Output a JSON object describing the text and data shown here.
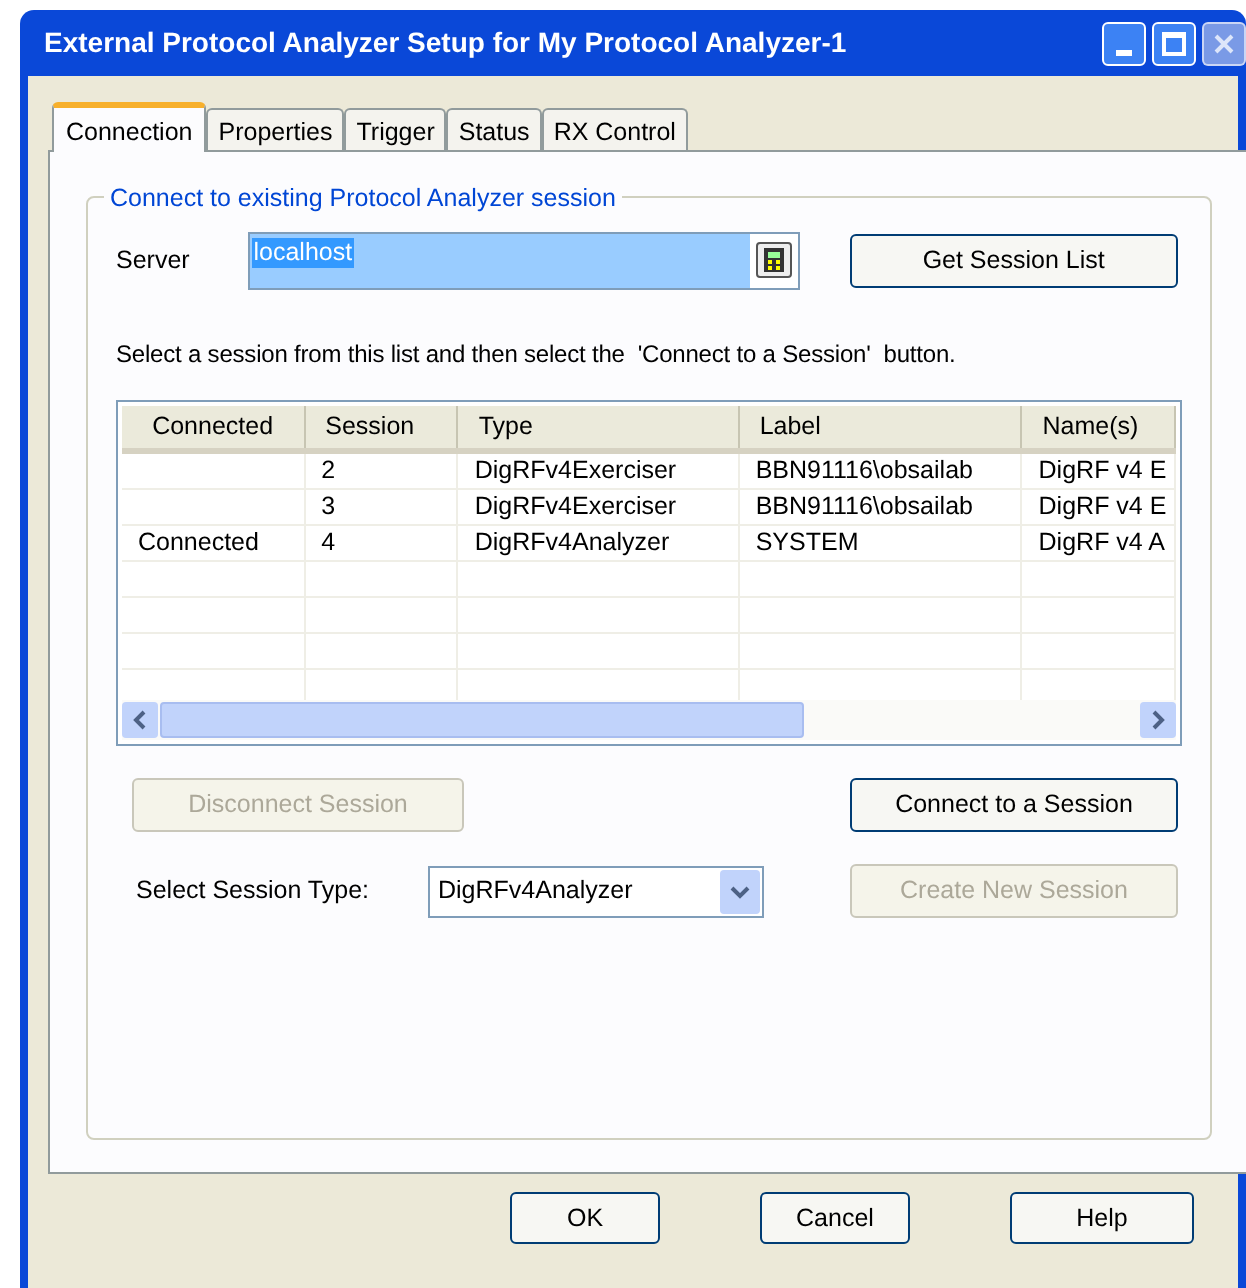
{
  "window": {
    "title": "External Protocol Analyzer Setup for My Protocol Analyzer-1"
  },
  "tabs": [
    {
      "label": "Connection",
      "selected": true
    },
    {
      "label": "Properties",
      "selected": false
    },
    {
      "label": "Trigger",
      "selected": false
    },
    {
      "label": "Status",
      "selected": false
    },
    {
      "label": "RX Control",
      "selected": false
    }
  ],
  "group": {
    "title": "Connect to existing Protocol Analyzer session"
  },
  "server": {
    "label": "Server",
    "value": "localhost"
  },
  "get_session_list": {
    "label": "Get Session List",
    "disabled": false
  },
  "instruction": "Select a session from this list and then select the  'Connect to a Session'  button.",
  "table": {
    "columns": [
      "Connected",
      "Session",
      "Type",
      "Label",
      "Name(s)"
    ],
    "rows": [
      [
        "",
        "2",
        "DigRFv4Exerciser",
        "BBN91116\\obsailab",
        "DigRF v4 E"
      ],
      [
        "",
        "3",
        "DigRFv4Exerciser",
        "BBN91116\\obsailab",
        "DigRF v4 E"
      ],
      [
        "Connected",
        "4",
        "DigRFv4Analyzer",
        "SYSTEM",
        "DigRF v4 A"
      ]
    ]
  },
  "disconnect": {
    "label": "Disconnect Session",
    "disabled": true
  },
  "connect": {
    "label": "Connect to a Session",
    "disabled": false
  },
  "session_type": {
    "label": "Select Session Type:",
    "value": "DigRFv4Analyzer"
  },
  "create": {
    "label": "Create New Session",
    "disabled": true
  },
  "buttons": [
    {
      "label": "OK"
    },
    {
      "label": "Cancel"
    },
    {
      "label": "Help"
    }
  ]
}
